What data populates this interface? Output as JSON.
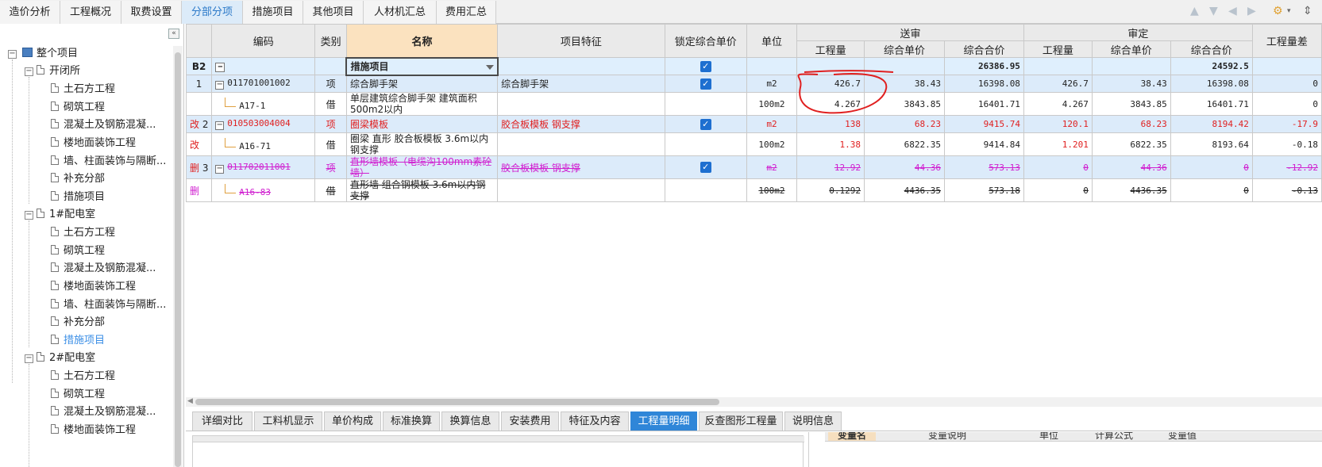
{
  "top_tabs": [
    "造价分析",
    "工程概况",
    "取费设置",
    "分部分项",
    "措施项目",
    "其他项目",
    "人材机汇总",
    "费用汇总"
  ],
  "active_top_tab": "分部分项",
  "tree": {
    "root": "整个项目",
    "groups": [
      {
        "name": "开闭所",
        "children": [
          "土石方工程",
          "砌筑工程",
          "混凝土及钢筋混凝...",
          "楼地面装饰工程",
          "墙、柱面装饰与隔断...",
          "补充分部",
          "措施项目"
        ]
      },
      {
        "name": "1#配电室",
        "children": [
          "土石方工程",
          "砌筑工程",
          "混凝土及钢筋混凝...",
          "楼地面装饰工程",
          "墙、柱面装饰与隔断...",
          "补充分部",
          "措施项目"
        ]
      },
      {
        "name": "2#配电室",
        "children": [
          "土石方工程",
          "砌筑工程",
          "混凝土及钢筋混凝...",
          "楼地面装饰工程"
        ]
      }
    ],
    "selected": "措施项目"
  },
  "columns": {
    "code": "编码",
    "type": "类别",
    "name": "名称",
    "feature": "项目特征",
    "lock": "锁定综合单价",
    "unit": "单位",
    "send_group": "送审",
    "review_group": "审定",
    "qty": "工程量",
    "unit_price": "综合单价",
    "total": "综合合价",
    "diff": "工程量差"
  },
  "rows": {
    "b2": {
      "label": "B2",
      "name": "措施项目",
      "send_total": "26386.95",
      "review_total": "24592.5"
    },
    "r1": {
      "no": "1",
      "code": "011701001002",
      "type": "项",
      "name": "综合脚手架",
      "feature": "综合脚手架",
      "unit": "m2",
      "s_qty": "426.7",
      "s_price": "38.43",
      "s_total": "16398.08",
      "r_qty": "426.7",
      "r_price": "38.43",
      "r_total": "16398.08",
      "diff": "0"
    },
    "r1a": {
      "code": "A17-1",
      "type": "借",
      "name": "单层建筑综合脚手架 建筑面积500m2以内",
      "unit": "100m2",
      "s_qty": "4.267",
      "s_price": "3843.85",
      "s_total": "16401.71",
      "r_qty": "4.267",
      "r_price": "3843.85",
      "r_total": "16401.71",
      "diff": "0"
    },
    "r2": {
      "mark": "改",
      "no": "2",
      "code": "010503004004",
      "type": "项",
      "name": "圈梁模板",
      "feature": "胶合板模板 钢支撑",
      "unit": "m2",
      "s_qty": "138",
      "s_price": "68.23",
      "s_total": "9415.74",
      "r_qty": "120.1",
      "r_price": "68.23",
      "r_total": "8194.42",
      "diff": "-17.9"
    },
    "r2a": {
      "mark": "改",
      "code": "A16-71",
      "type": "借",
      "name": "圈梁 直形 胶合板模板 3.6m以内钢支撑",
      "unit": "100m2",
      "s_qty": "1.38",
      "s_price": "6822.35",
      "s_total": "9414.84",
      "r_qty": "1.201",
      "r_price": "6822.35",
      "r_total": "8193.64",
      "diff": "-0.18"
    },
    "r3": {
      "mark": "删",
      "no": "3",
      "code": "011702011001",
      "type": "项",
      "name": "直形墙模板（电缆沟100mm素砼墙）",
      "feature": "胶合板模板 钢支撑",
      "unit": "m2",
      "s_qty": "12.92",
      "s_price": "44.36",
      "s_total": "573.13",
      "r_qty": "0",
      "r_price": "44.36",
      "r_total": "0",
      "diff": "-12.92"
    },
    "r3a": {
      "mark": "删",
      "code": "A16-83",
      "type": "借",
      "name": "直形墙 组合钢模板 3.6m以内钢支撑",
      "unit": "100m2",
      "s_qty": "0.1292",
      "s_price": "4436.35",
      "s_total": "573.18",
      "r_qty": "0",
      "r_price": "4436.35",
      "r_total": "0",
      "diff": "-0.13"
    }
  },
  "bottom_tabs": [
    "详细对比",
    "工料机显示",
    "单价构成",
    "标准换算",
    "换算信息",
    "安装费用",
    "特征及内容",
    "工程量明细",
    "反查图形工程量",
    "说明信息"
  ],
  "active_bottom_tab": "工程量明细",
  "bottom_right_headers": [
    "变量名",
    "变量说明",
    "单位",
    "计算公式",
    "变量值"
  ],
  "colors": {
    "accent": "#2f86d8",
    "modified": "#e02020",
    "deleted": "#d020d0",
    "annotation": "#e02020"
  }
}
